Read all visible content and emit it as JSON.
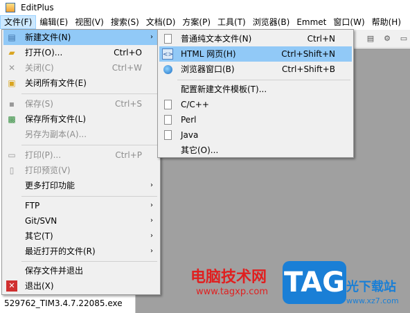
{
  "window": {
    "title": "EditPlus"
  },
  "menubar": [
    {
      "label": "文件(F)",
      "active": true
    },
    {
      "label": "编辑(E)"
    },
    {
      "label": "视图(V)"
    },
    {
      "label": "搜索(S)"
    },
    {
      "label": "文档(D)"
    },
    {
      "label": "方案(P)"
    },
    {
      "label": "工具(T)"
    },
    {
      "label": "浏览器(B)"
    },
    {
      "label": "Emmet"
    },
    {
      "label": "窗口(W)"
    },
    {
      "label": "帮助(H)"
    }
  ],
  "file_menu": {
    "items": [
      {
        "label": "新建文件(N)",
        "shortcut": "",
        "arrow": "›",
        "icon": "new-file-icon",
        "highlighted": true
      },
      {
        "label": "打开(O)...",
        "shortcut": "Ctrl+O",
        "icon": "open-folder-icon"
      },
      {
        "label": "关闭(C)",
        "shortcut": "Ctrl+W",
        "icon": "close-x-icon",
        "disabled": true
      },
      {
        "label": "关闭所有文件(E)",
        "shortcut": "",
        "icon": "close-all-icon"
      },
      {
        "label": "保存(S)",
        "shortcut": "Ctrl+S",
        "icon": "save-icon",
        "disabled": true
      },
      {
        "label": "保存所有文件(L)",
        "shortcut": "",
        "icon": "save-all-icon"
      },
      {
        "label": "另存为副本(A)...",
        "shortcut": "",
        "icon": "",
        "disabled": true
      },
      {
        "label": "打印(P)...",
        "shortcut": "Ctrl+P",
        "icon": "print-icon",
        "disabled": true
      },
      {
        "label": "打印预览(V)",
        "shortcut": "",
        "icon": "print-preview-icon",
        "disabled": true
      },
      {
        "label": "更多打印功能",
        "shortcut": "",
        "arrow": "›",
        "icon": ""
      },
      {
        "label": "FTP",
        "arrow": "›"
      },
      {
        "label": "Git/SVN",
        "arrow": "›"
      },
      {
        "label": "其它(T)",
        "arrow": "›"
      },
      {
        "label": "最近打开的文件(R)",
        "arrow": "›"
      },
      {
        "label": "保存文件并退出"
      },
      {
        "label": "退出(X)",
        "icon": "exit-icon"
      }
    ]
  },
  "new_file_submenu": {
    "items": [
      {
        "label": "普通纯文本文件(N)",
        "shortcut": "Ctrl+N",
        "icon": "text-file-icon"
      },
      {
        "label": "HTML 网页(H)",
        "shortcut": "Ctrl+Shift+N",
        "icon": "html-file-icon",
        "highlighted": true
      },
      {
        "label": "浏览器窗口(B)",
        "shortcut": "Ctrl+Shift+B",
        "icon": "browser-window-icon"
      },
      {
        "label": "配置新建文件模板(T)..."
      },
      {
        "label": "C/C++",
        "icon": "c-file-icon"
      },
      {
        "label": "Perl",
        "icon": "perl-file-icon"
      },
      {
        "label": "Java",
        "icon": "java-file-icon"
      },
      {
        "label": "其它(O)..."
      }
    ]
  },
  "status": {
    "file_name": "529762_TIM3.4.7.22085.exe"
  },
  "watermark": {
    "site_name": "电脑技术网",
    "site_url": "www.tagxp.com",
    "tag": "TAG",
    "right_text": "光下载站",
    "right_url": "www.xz7.com"
  },
  "colors": {
    "highlight": "#91c9f7",
    "menu_bg": "#f0f0f0",
    "workspace": "#a0a0a0"
  }
}
